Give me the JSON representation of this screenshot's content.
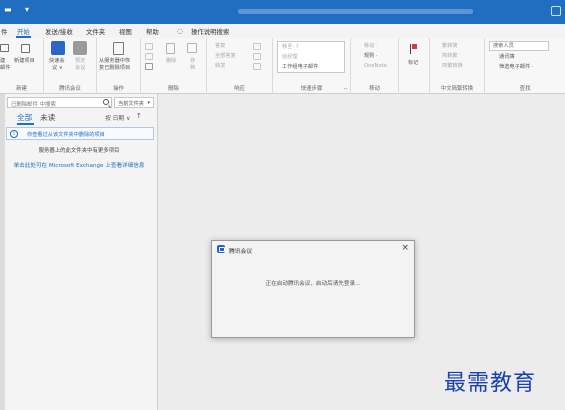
{
  "menu": {
    "file_tab": "件",
    "tabs": [
      "开始",
      "发送/接收",
      "文件夹",
      "视图",
      "帮助"
    ],
    "search_hint": "操作说明搜索"
  },
  "ribbon": {
    "new": {
      "new_email": [
        "建",
        "邮件"
      ],
      "new_items": "新建项目",
      "label": "新建"
    },
    "meeting": {
      "btn1": [
        "快速会",
        "议 ∨"
      ],
      "btn2": [
        "预定",
        "会议"
      ],
      "label": "腾讯会议"
    },
    "actions": {
      "recover": [
        "从服务器中恢",
        "复已删除项目"
      ],
      "label": "操作"
    },
    "delete": {
      "delete": "删除",
      "archive": [
        "存",
        "档"
      ],
      "label": "删除"
    },
    "respond": {
      "reply": "答复",
      "reply_all": "全部答复",
      "forward": "转发",
      "label": "响应"
    },
    "quicksteps": {
      "s1": "移至: ?",
      "s2": "给经理",
      "s3": "工作组电子邮件",
      "label": "快速步骤"
    },
    "move": {
      "move": "移动 ·",
      "rules": "规则 ·",
      "onenote": "OneNote",
      "label": "移动"
    },
    "tags": {
      "tag": "标记"
    },
    "chinese": {
      "c1": "繁转简",
      "c2": "简转繁",
      "c3": "简繁转换",
      "label": "中文简繁转换"
    },
    "find": {
      "search_people": "搜索人员",
      "address_book": "通讯簿",
      "filter": "筛选电子邮件 ·",
      "label": "查找"
    }
  },
  "nav": {
    "search_placeholder": "已删除邮件 中搜索",
    "scope": "当前文件夹",
    "tab_all": "全部",
    "tab_unread": "未读",
    "sort": "按 日期 ∨",
    "sort_arrow": "↑",
    "info_text": "你查看过从该文件夹中删除的项目",
    "more_items": "服务器上的此文件夹中有更多项目",
    "exchange_link": "单击此处可在 Microsoft Exchange 上查看详细信息"
  },
  "dialog": {
    "title": "腾讯会议",
    "close": "×",
    "message": "正在启动腾讯会议，启动后请先登录..."
  },
  "watermark": "最需教育",
  "colors": {
    "title_bar": "#1f6ec0",
    "accent": "#1f6ec0",
    "watermark": "#1a3fae"
  }
}
